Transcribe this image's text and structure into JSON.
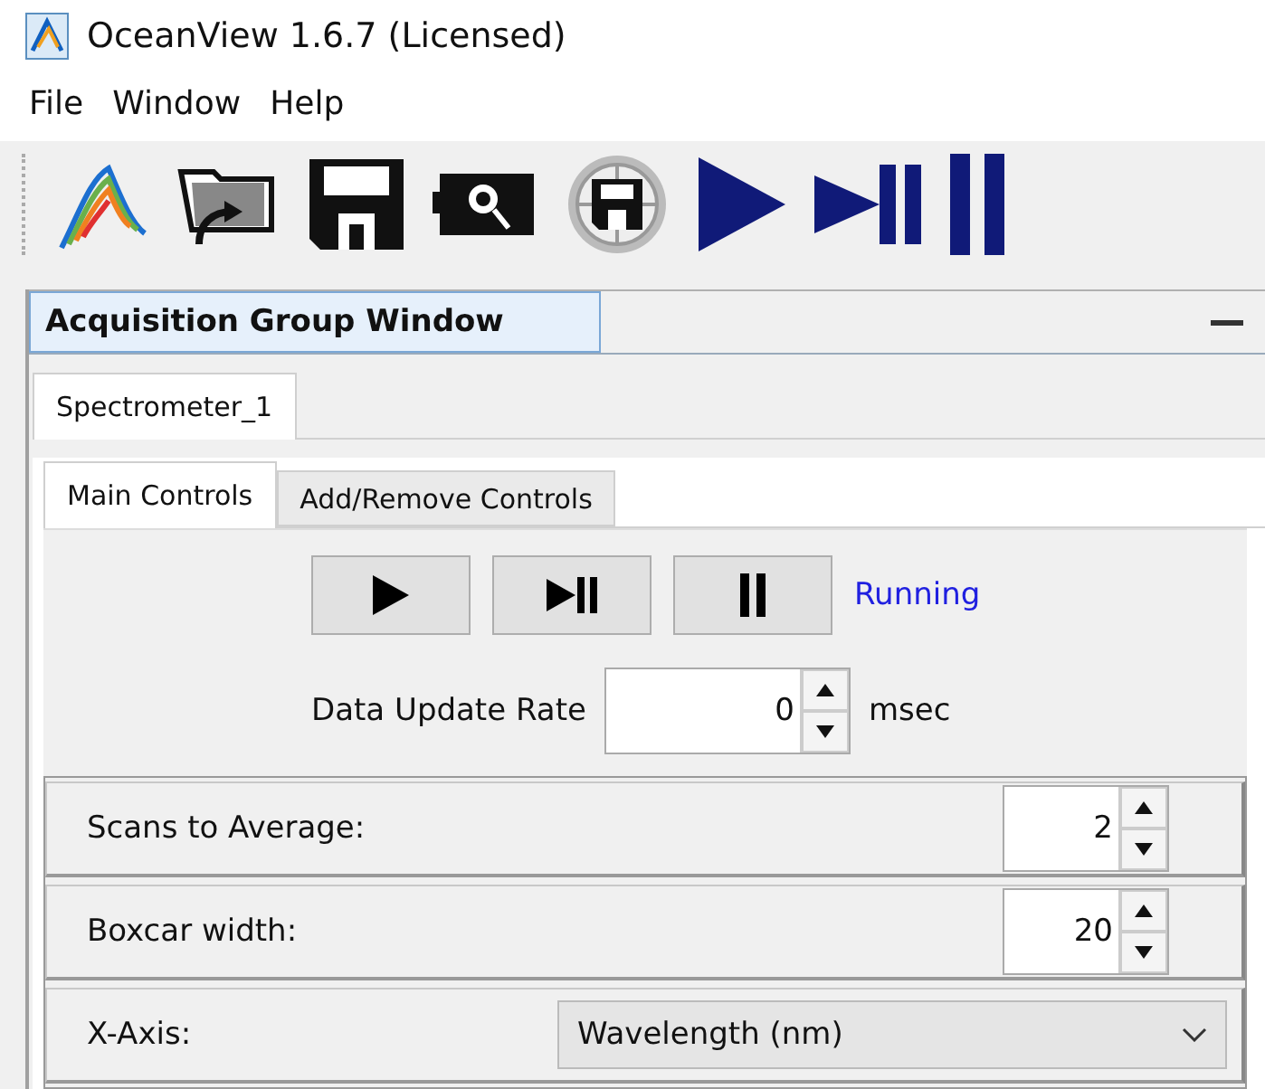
{
  "window": {
    "title": "OceanView 1.6.7 (Licensed)"
  },
  "menu": [
    "File",
    "Window",
    "Help"
  ],
  "panel": {
    "title": "Acquisition Group Window"
  },
  "device_tabs": [
    {
      "label": "Spectrometer_1",
      "selected": true
    }
  ],
  "tabs": [
    {
      "label": "Main Controls",
      "selected": true
    },
    {
      "label": "Add/Remove Controls",
      "selected": false
    }
  ],
  "status": "Running",
  "update_rate": {
    "label": "Data Update Rate",
    "value": "0",
    "unit": "msec"
  },
  "settings": [
    {
      "kind": "spinner",
      "label": "Scans to Average:",
      "value": "2"
    },
    {
      "kind": "spinner",
      "label": "Boxcar width:",
      "value": "20"
    },
    {
      "kind": "dropdown",
      "label": "X-Axis:",
      "value": "Wavelength (nm)"
    }
  ]
}
